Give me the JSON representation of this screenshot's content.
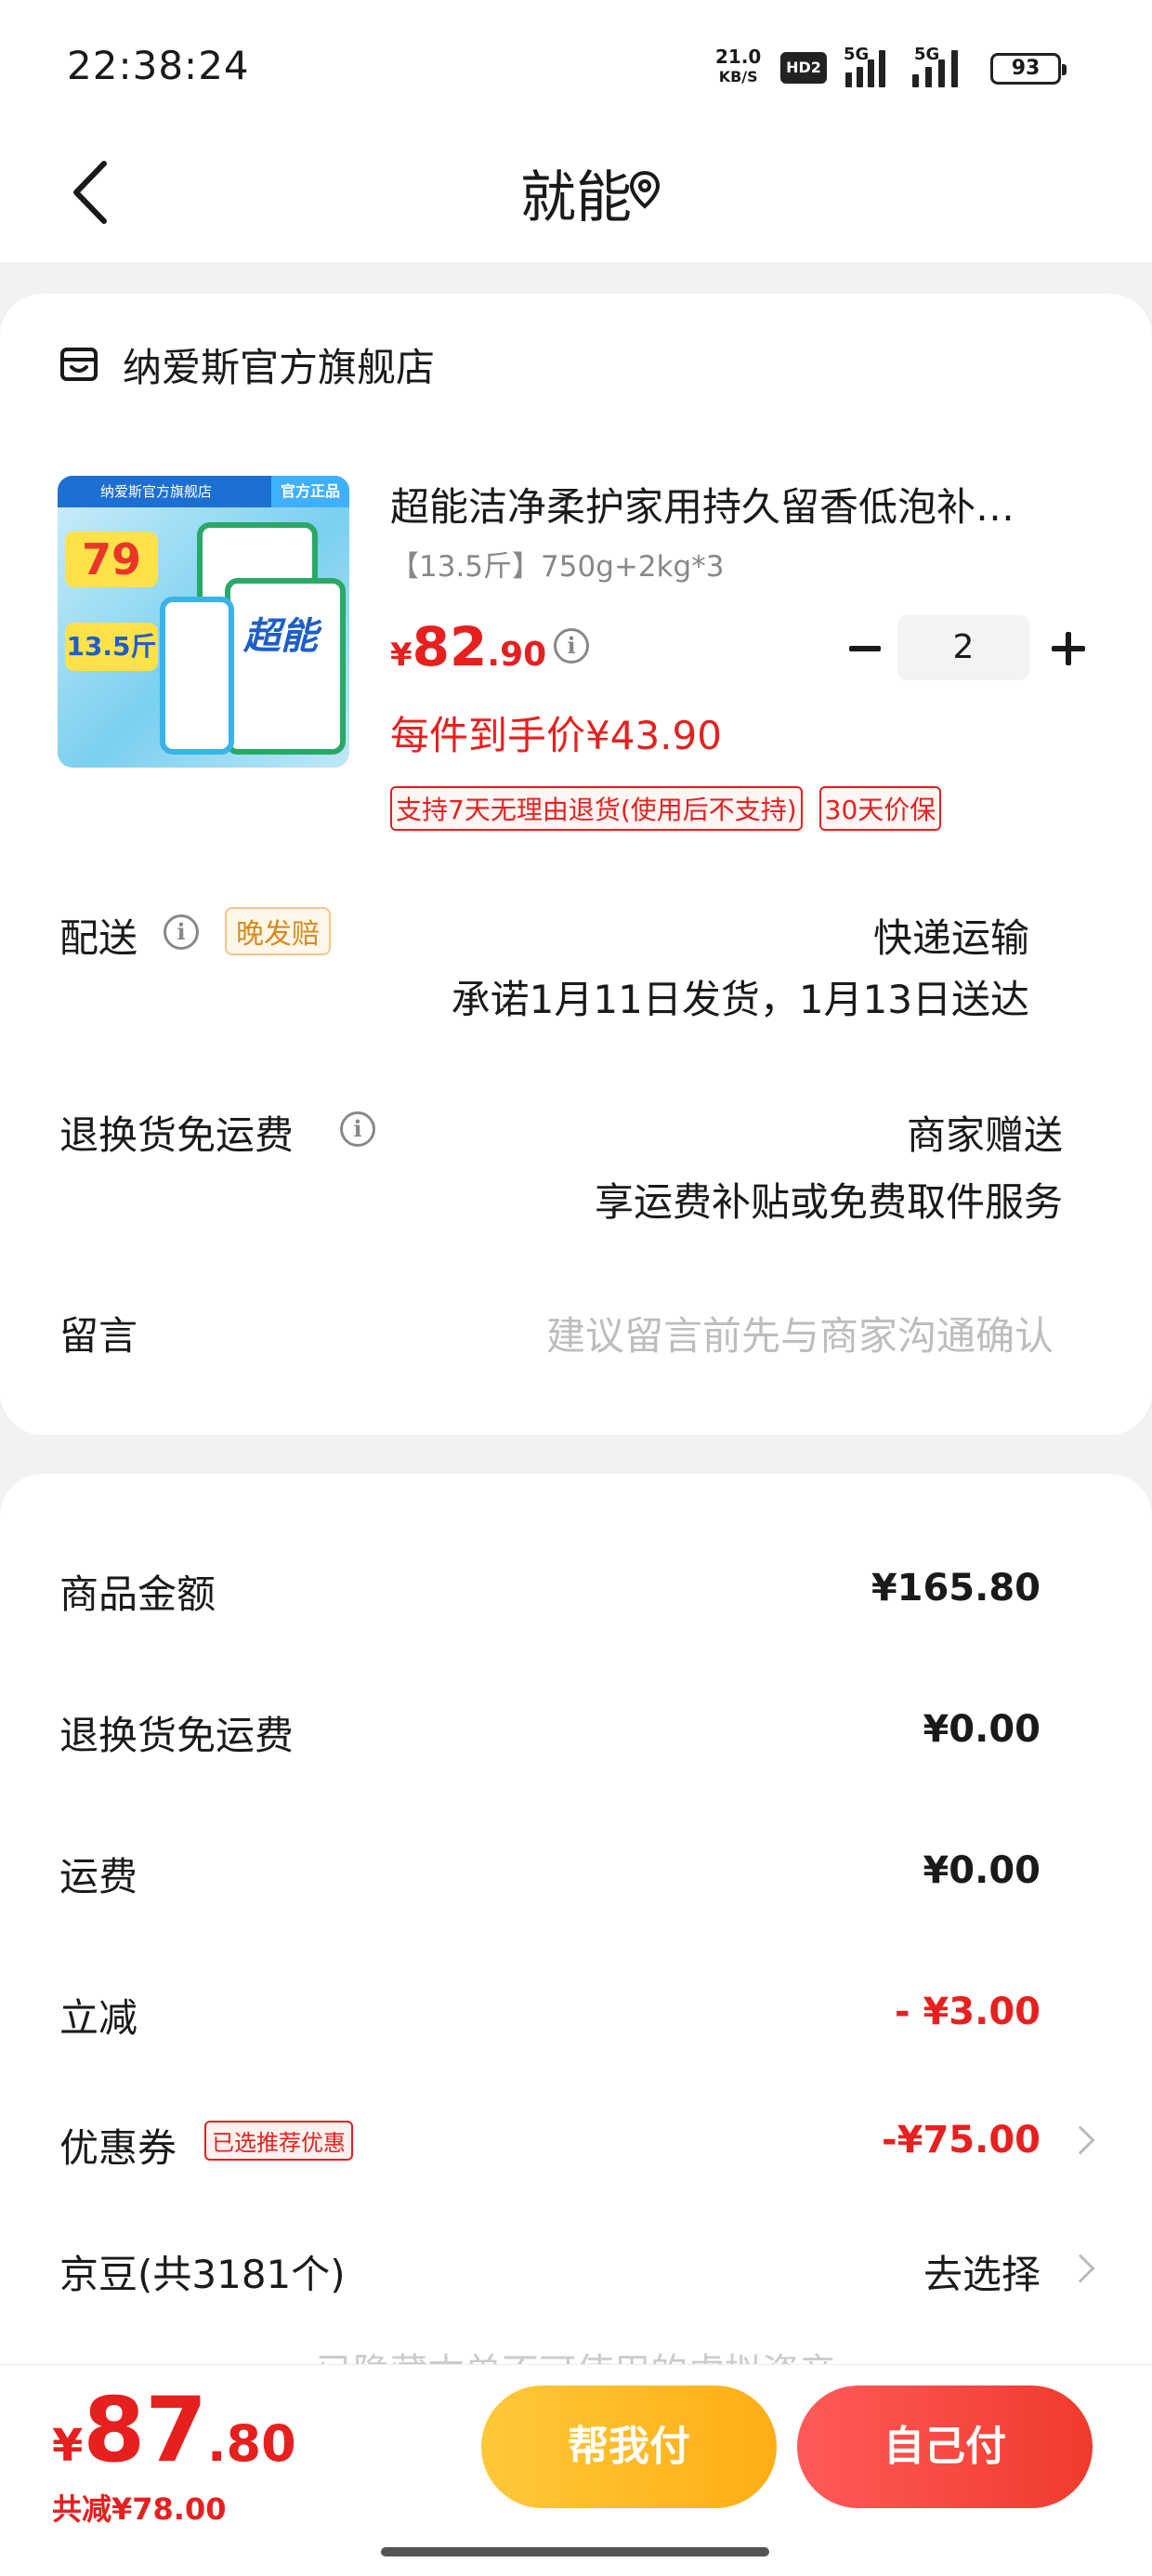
{
  "status_bar": {
    "time": "22:38:24",
    "net_speed": "21.0",
    "net_unit": "KB/S",
    "hd": "HD2",
    "sig1": "5G",
    "sig2": "5G",
    "battery": "93"
  },
  "header": {
    "title": "就能",
    "back_icon": "chevron-left-icon",
    "location_icon": "location-pin-icon"
  },
  "store": {
    "icon": "store-icon",
    "name": "纳爱斯官方旗舰店"
  },
  "product": {
    "title": "超能洁净柔护家用持久留香低泡补…",
    "spec": "【13.5斤】750g+2kg*3",
    "price_symbol": "¥",
    "price_int": "82",
    "price_dec": ".90",
    "unit_price": "每件到手价¥43.90",
    "quantity": "2",
    "badges": [
      "支持7天无理由退货(使用后不支持)",
      "30天价保"
    ],
    "thumb": {
      "topbar": "纳爱斯官方旗舰店",
      "topbadge": "官方正品",
      "brand": "超能",
      "tag_price": "79",
      "tag_weight": "13.5斤"
    }
  },
  "delivery": {
    "label": "配送",
    "badge": "晚发赔",
    "method": "快递运输",
    "promise": "承诺1月11日发货，1月13日送达"
  },
  "return_shipping": {
    "label": "退换货免运费",
    "value": "商家赠送",
    "desc": "享运费补贴或免费取件服务"
  },
  "message": {
    "label": "留言",
    "placeholder": "建议留言前先与商家沟通确认"
  },
  "summary": {
    "goods_amount_label": "商品金额",
    "goods_amount": "¥165.80",
    "return_free_label": "退换货免运费",
    "return_free": "¥0.00",
    "shipping_label": "运费",
    "shipping": "¥0.00",
    "discount_label": "立减",
    "discount": "- ¥3.00",
    "coupon_label": "优惠券",
    "coupon_tag": "已选推荐优惠",
    "coupon": "-¥75.00",
    "beans_label": "京豆(共3181个)",
    "beans_action": "去选择",
    "faded_note": "已隐藏本单不可使用的虚拟资产"
  },
  "bottom_bar": {
    "total_symbol": "¥",
    "total_int": "87",
    "total_dec": ".80",
    "saved": "共减¥78.00",
    "help_pay": "帮我付",
    "self_pay": "自己付"
  },
  "colors": {
    "price_red": "#e6201e",
    "help_btn": "#ffb81c",
    "self_btn": "#f0463a"
  }
}
